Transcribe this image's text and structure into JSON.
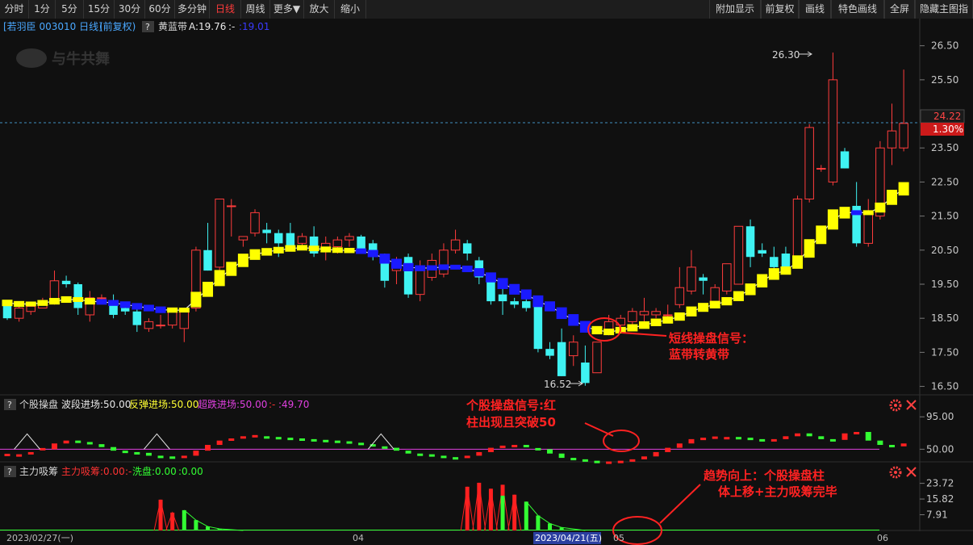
{
  "toolbar": {
    "left_items": [
      "分时",
      "1分",
      "5分",
      "15分",
      "30分",
      "60分",
      "多分钟",
      "日线",
      "周线",
      "更多▼",
      "放大",
      "缩小"
    ],
    "active": "日线",
    "right_items": [
      "附加显示",
      "前复权",
      "画线",
      "特色画线",
      "全屏",
      "隐藏主图指标"
    ]
  },
  "main_header": {
    "name": "[若羽臣 003010 日线]",
    "adjust": "(前复权)",
    "help": "?",
    "indicator": "黄蓝带",
    "a_label": "A:19.76",
    "dash": ":-",
    "value2": ":19.01"
  },
  "logo_text": "与牛共舞",
  "current_price": "24.22",
  "current_pct": "1.30%",
  "max_label": "26.30",
  "min_label": "16.52",
  "annotations": {
    "signal1_line1": "短线操盘信号：",
    "signal1_line2": "蓝带转黄带",
    "signal2_line1": "个股操盘信号:红",
    "signal2_line2": "柱出现且突破50",
    "signal3_line1": "趋势向上：个股操盘柱",
    "signal3_line2": "体上移+主力吸筹完毕"
  },
  "panel2_header": {
    "help": "?",
    "name": "个股操盘",
    "l1": "波段进场:50.00",
    "l2": "反弹进场:50.00",
    "l3": "超跌进场:50.00",
    "dash": ":-",
    "l4": ":49.70"
  },
  "panel3_header": {
    "help": "?",
    "name": "主力吸筹",
    "l1": "主力吸筹:0.00",
    "dash": ":-",
    "l2": "洗盘:0.00",
    "l3": ":0.00"
  },
  "x_labels": [
    "2023/02/27(一)",
    "04",
    "2023/04/21(五)",
    "05",
    "06"
  ],
  "colors": {
    "up": "#ff3c3c",
    "down": "#3ff2f2",
    "yellow": "#ffff00",
    "blue": "#1a1aff",
    "magenta": "#e040e0",
    "green": "#33ff33",
    "red": "#ff2020"
  },
  "chart_data": [
    {
      "type": "candlestick",
      "title": "若羽臣 003010 日线",
      "ylim": [
        16.3,
        26.8
      ],
      "y_ticks": [
        16.5,
        17.5,
        18.5,
        19.5,
        20.5,
        21.5,
        22.5,
        23.5,
        25.5,
        26.5
      ],
      "y_tick_labels": [
        "16.50",
        "17.50",
        "18.50",
        "19.50",
        "20.50",
        "21.50",
        "22.50",
        "23.50",
        "25.50",
        "26.50"
      ],
      "current_price": 24.22,
      "high_marker": 26.3,
      "low_marker": 16.52,
      "candles": [
        {
          "o": 19.0,
          "h": 19.0,
          "l": 18.45,
          "c": 18.5
        },
        {
          "o": 18.5,
          "h": 18.9,
          "l": 18.4,
          "c": 18.8
        },
        {
          "o": 18.7,
          "h": 18.9,
          "l": 18.6,
          "c": 18.85
        },
        {
          "o": 18.8,
          "h": 19.1,
          "l": 18.8,
          "c": 19.0
        },
        {
          "o": 19.0,
          "h": 19.9,
          "l": 18.9,
          "c": 19.6
        },
        {
          "o": 19.6,
          "h": 19.75,
          "l": 19.4,
          "c": 19.5
        },
        {
          "o": 19.5,
          "h": 19.55,
          "l": 18.6,
          "c": 18.8
        },
        {
          "o": 18.6,
          "h": 19.3,
          "l": 18.4,
          "c": 19.1
        },
        {
          "o": 19.1,
          "h": 19.2,
          "l": 19.0,
          "c": 19.1
        },
        {
          "o": 19.0,
          "h": 19.2,
          "l": 18.5,
          "c": 18.6
        },
        {
          "o": 18.8,
          "h": 18.9,
          "l": 18.6,
          "c": 18.7
        },
        {
          "o": 18.7,
          "h": 18.8,
          "l": 18.1,
          "c": 18.3
        },
        {
          "o": 18.2,
          "h": 18.5,
          "l": 18.1,
          "c": 18.4
        },
        {
          "o": 18.3,
          "h": 18.6,
          "l": 18.2,
          "c": 18.3
        },
        {
          "o": 18.3,
          "h": 18.8,
          "l": 18.2,
          "c": 18.7
        },
        {
          "o": 18.2,
          "h": 18.8,
          "l": 17.8,
          "c": 18.7
        },
        {
          "o": 18.8,
          "h": 20.6,
          "l": 18.7,
          "c": 20.5
        },
        {
          "o": 20.5,
          "h": 21.3,
          "l": 19.9,
          "c": 19.9
        },
        {
          "o": 20.0,
          "h": 22.0,
          "l": 19.9,
          "c": 22.0
        },
        {
          "o": 21.8,
          "h": 22.0,
          "l": 20.9,
          "c": 21.8
        },
        {
          "o": 20.8,
          "h": 20.9,
          "l": 20.6,
          "c": 20.9
        },
        {
          "o": 21.0,
          "h": 21.7,
          "l": 20.9,
          "c": 21.6
        },
        {
          "o": 21.1,
          "h": 21.3,
          "l": 20.7,
          "c": 21.0
        },
        {
          "o": 21.0,
          "h": 21.1,
          "l": 20.3,
          "c": 20.7
        },
        {
          "o": 21.0,
          "h": 21.3,
          "l": 20.5,
          "c": 20.6
        },
        {
          "o": 20.7,
          "h": 21.0,
          "l": 20.6,
          "c": 20.9
        },
        {
          "o": 20.9,
          "h": 21.2,
          "l": 20.3,
          "c": 20.4
        },
        {
          "o": 20.5,
          "h": 20.9,
          "l": 20.2,
          "c": 20.7
        },
        {
          "o": 20.6,
          "h": 20.9,
          "l": 20.4,
          "c": 20.8
        },
        {
          "o": 20.8,
          "h": 21.0,
          "l": 20.6,
          "c": 20.9
        },
        {
          "o": 20.9,
          "h": 20.95,
          "l": 20.4,
          "c": 20.5
        },
        {
          "o": 20.7,
          "h": 20.8,
          "l": 20.2,
          "c": 20.3
        },
        {
          "o": 20.3,
          "h": 20.4,
          "l": 19.4,
          "c": 19.6
        },
        {
          "o": 19.9,
          "h": 20.3,
          "l": 19.5,
          "c": 20.2
        },
        {
          "o": 20.3,
          "h": 20.4,
          "l": 19.1,
          "c": 19.2
        },
        {
          "o": 19.2,
          "h": 20.2,
          "l": 19.0,
          "c": 19.9
        },
        {
          "o": 19.7,
          "h": 20.4,
          "l": 19.6,
          "c": 20.2
        },
        {
          "o": 19.8,
          "h": 20.7,
          "l": 19.7,
          "c": 20.5
        },
        {
          "o": 20.5,
          "h": 21.1,
          "l": 20.4,
          "c": 20.8
        },
        {
          "o": 20.7,
          "h": 20.8,
          "l": 20.2,
          "c": 20.4
        },
        {
          "o": 20.2,
          "h": 20.3,
          "l": 19.5,
          "c": 19.7
        },
        {
          "o": 19.7,
          "h": 19.8,
          "l": 18.9,
          "c": 19.0
        },
        {
          "o": 19.2,
          "h": 19.4,
          "l": 18.6,
          "c": 19.0
        },
        {
          "o": 19.0,
          "h": 19.1,
          "l": 18.8,
          "c": 18.9
        },
        {
          "o": 19.0,
          "h": 19.1,
          "l": 18.7,
          "c": 18.8
        },
        {
          "o": 18.9,
          "h": 19.0,
          "l": 17.5,
          "c": 17.6
        },
        {
          "o": 17.6,
          "h": 17.8,
          "l": 17.3,
          "c": 17.4
        },
        {
          "o": 17.8,
          "h": 18.2,
          "l": 16.8,
          "c": 16.8
        },
        {
          "o": 17.4,
          "h": 18.0,
          "l": 17.1,
          "c": 17.8
        },
        {
          "o": 17.2,
          "h": 17.7,
          "l": 16.52,
          "c": 16.6
        },
        {
          "o": 16.9,
          "h": 17.8,
          "l": 16.9,
          "c": 17.8
        },
        {
          "o": 18.1,
          "h": 18.6,
          "l": 18.0,
          "c": 18.4
        },
        {
          "o": 18.3,
          "h": 18.6,
          "l": 18.1,
          "c": 18.5
        },
        {
          "o": 18.4,
          "h": 18.8,
          "l": 18.2,
          "c": 18.7
        },
        {
          "o": 18.6,
          "h": 19.1,
          "l": 18.4,
          "c": 18.7
        },
        {
          "o": 18.6,
          "h": 18.8,
          "l": 18.5,
          "c": 18.7
        },
        {
          "o": 18.6,
          "h": 18.9,
          "l": 18.4,
          "c": 18.6
        },
        {
          "o": 18.9,
          "h": 20.0,
          "l": 18.8,
          "c": 19.4
        },
        {
          "o": 19.3,
          "h": 20.5,
          "l": 19.2,
          "c": 20.0
        },
        {
          "o": 19.7,
          "h": 19.8,
          "l": 19.2,
          "c": 19.6
        },
        {
          "o": 19.0,
          "h": 19.5,
          "l": 18.9,
          "c": 19.4
        },
        {
          "o": 19.3,
          "h": 20.1,
          "l": 19.2,
          "c": 20.1
        },
        {
          "o": 19.5,
          "h": 21.2,
          "l": 19.5,
          "c": 21.2
        },
        {
          "o": 21.2,
          "h": 21.4,
          "l": 20.0,
          "c": 20.3
        },
        {
          "o": 20.5,
          "h": 20.7,
          "l": 20.3,
          "c": 20.4
        },
        {
          "o": 20.3,
          "h": 20.6,
          "l": 19.7,
          "c": 20.0
        },
        {
          "o": 20.4,
          "h": 20.6,
          "l": 19.8,
          "c": 20.0
        },
        {
          "o": 20.2,
          "h": 22.1,
          "l": 20.0,
          "c": 22.0
        },
        {
          "o": 22.0,
          "h": 24.2,
          "l": 21.9,
          "c": 24.1
        },
        {
          "o": 22.9,
          "h": 23.0,
          "l": 22.8,
          "c": 22.9
        },
        {
          "o": 22.5,
          "h": 26.3,
          "l": 22.4,
          "c": 25.5
        },
        {
          "o": 23.4,
          "h": 23.5,
          "l": 22.9,
          "c": 22.9
        },
        {
          "o": 21.8,
          "h": 22.5,
          "l": 20.6,
          "c": 20.7
        },
        {
          "o": 20.7,
          "h": 22.0,
          "l": 20.6,
          "c": 21.6
        },
        {
          "o": 21.5,
          "h": 23.7,
          "l": 21.4,
          "c": 23.5
        },
        {
          "o": 23.5,
          "h": 24.8,
          "l": 23.0,
          "c": 24.0
        },
        {
          "o": 23.5,
          "h": 25.8,
          "l": 23.4,
          "c": 24.22
        }
      ],
      "band_line": [
        18.95,
        18.92,
        18.92,
        18.95,
        19.0,
        19.05,
        19.05,
        19.0,
        18.98,
        18.95,
        18.9,
        18.85,
        18.8,
        18.75,
        18.74,
        18.74,
        19.05,
        19.35,
        19.68,
        19.95,
        20.2,
        20.37,
        20.45,
        20.5,
        20.55,
        20.57,
        20.55,
        20.52,
        20.5,
        20.49,
        20.47,
        20.4,
        20.25,
        20.1,
        20.0,
        19.97,
        19.98,
        20.0,
        20.0,
        19.95,
        19.85,
        19.7,
        19.52,
        19.35,
        19.2,
        19.0,
        18.85,
        18.65,
        18.45,
        18.25,
        18.15,
        18.1,
        18.15,
        18.22,
        18.3,
        18.38,
        18.45,
        18.55,
        18.7,
        18.82,
        18.9,
        19.0,
        19.15,
        19.35,
        19.6,
        19.8,
        19.9,
        20.15,
        20.55,
        20.95,
        21.4,
        21.6,
        21.6,
        21.6,
        21.75,
        22.05,
        22.3
      ],
      "band_color": [
        "y",
        "y",
        "y",
        "y",
        "y",
        "y",
        "y",
        "y",
        "b",
        "b",
        "b",
        "b",
        "b",
        "b",
        "y",
        "y",
        "y",
        "y",
        "y",
        "y",
        "y",
        "y",
        "y",
        "y",
        "y",
        "y",
        "y",
        "y",
        "y",
        "y",
        "b",
        "b",
        "b",
        "b",
        "b",
        "b",
        "b",
        "b",
        "b",
        "b",
        "b",
        "b",
        "b",
        "b",
        "b",
        "b",
        "b",
        "b",
        "b",
        "b",
        "y",
        "y",
        "y",
        "y",
        "y",
        "y",
        "y",
        "y",
        "y",
        "y",
        "y",
        "y",
        "y",
        "y",
        "y",
        "y",
        "y",
        "y",
        "y",
        "y",
        "y",
        "y",
        "b",
        "y",
        "y",
        "y",
        "y"
      ]
    },
    {
      "type": "bar",
      "title": "个股操盘",
      "ylim": [
        28,
        102
      ],
      "y_tick_labels": [
        "95.00",
        "50.00"
      ],
      "y_ticks": [
        95,
        50
      ],
      "baseline": 50,
      "values": [
        42,
        43,
        46,
        50,
        58,
        62,
        60,
        57,
        53,
        48,
        46,
        45,
        41,
        40,
        38,
        41,
        48,
        56,
        62,
        65,
        68,
        68,
        67,
        66,
        65,
        64,
        63,
        62,
        61,
        59,
        57,
        54,
        52,
        48,
        44,
        43,
        41,
        39,
        38,
        41,
        46,
        52,
        55,
        56,
        54,
        50,
        44,
        38,
        36,
        34,
        32,
        33,
        34,
        36,
        40,
        46,
        52,
        58,
        64,
        66,
        66,
        67,
        66,
        64,
        63,
        64,
        68,
        72,
        68,
        64,
        63,
        72,
        74,
        62,
        56,
        54,
        58
      ],
      "triangles_at": [
        1,
        12,
        31
      ]
    },
    {
      "type": "bar",
      "title": "主力吸筹",
      "ylim": [
        0,
        26
      ],
      "y_tick_labels": [
        "23.72",
        "15.82",
        "7.91"
      ],
      "y_ticks": [
        23.72,
        15.82,
        7.91
      ],
      "red_bars": {
        "13": 15.5,
        "14": 9.0,
        "39": 22.0,
        "40": 24.0,
        "41": 21.0,
        "42": 23.0,
        "43": 18.0
      },
      "green_bars": {
        "15": 10.2,
        "16": 5.2,
        "17": 2.0,
        "18": 0.8,
        "42": 17.5,
        "44": 14.5,
        "45": 7.5,
        "46": 3.5,
        "47": 1.5
      }
    }
  ]
}
